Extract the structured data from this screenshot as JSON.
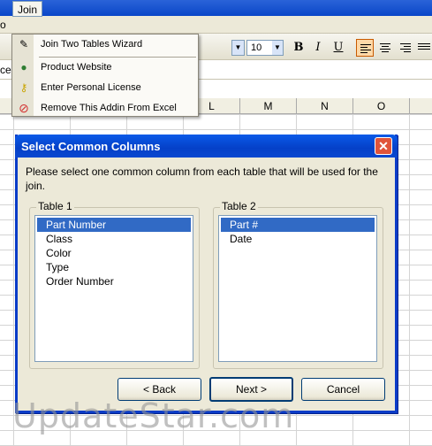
{
  "menubar": {
    "partial_item": "o",
    "join": "Join"
  },
  "toolbar": {
    "font_size": "10",
    "bold": "B",
    "italic": "I",
    "underline": "U"
  },
  "formula_bar": {
    "partial_namebox": "ce"
  },
  "columns": [
    "L",
    "M",
    "N",
    "O"
  ],
  "join_menu": {
    "items": [
      {
        "label": "Join Two Tables Wizard",
        "icon": "join-wizard-icon"
      },
      {
        "label": "Product Website",
        "icon": "globe-icon"
      },
      {
        "label": "Enter Personal License",
        "icon": "key-icon"
      },
      {
        "label": "Remove This Addin From Excel",
        "icon": "remove-icon"
      }
    ]
  },
  "dialog": {
    "title": "Select Common Columns",
    "prompt": "Please select one common column from each table that will be used for the join.",
    "table1": {
      "label": "Table 1",
      "items": [
        "Part Number",
        "Class",
        "Color",
        "Type",
        "Order Number"
      ],
      "selected": "Part Number"
    },
    "table2": {
      "label": "Table 2",
      "items": [
        "Part #",
        "Date"
      ],
      "selected": "Part #"
    },
    "buttons": {
      "back": "< Back",
      "next": "Next >",
      "cancel": "Cancel"
    }
  },
  "watermark": "UpdateStar.com",
  "colors": {
    "title_blue": "#0a5ae8",
    "selection": "#316ac5",
    "close_red": "#e0543a",
    "dialog_bg": "#ece9d8"
  }
}
